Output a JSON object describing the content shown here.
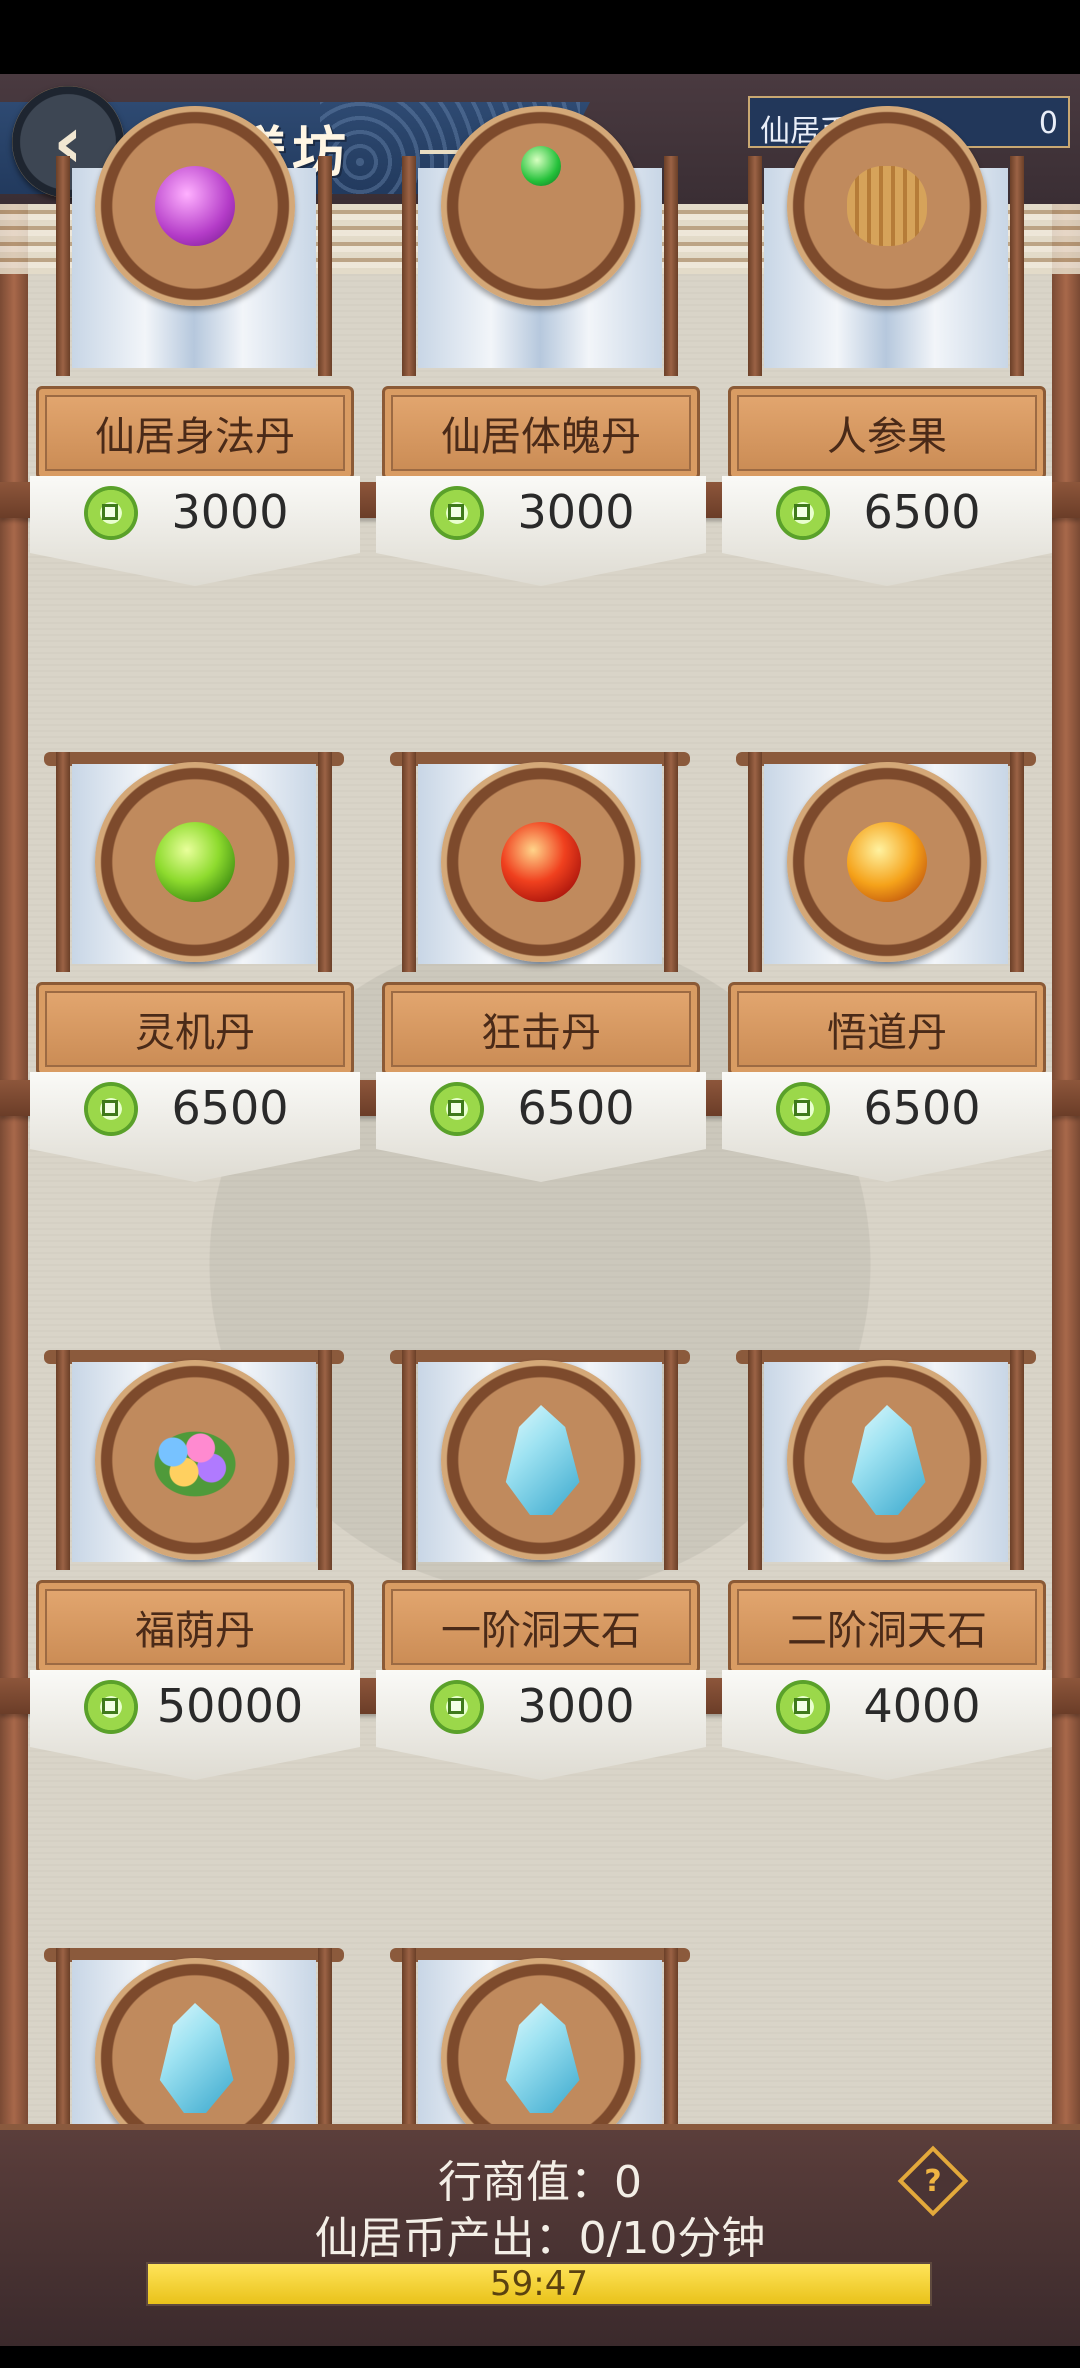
{
  "header": {
    "back_icon": "chevron-left-icon",
    "title": "珍馐坊",
    "currency_label": "仙居币",
    "currency_value": "0"
  },
  "items": [
    {
      "name": "仙居身法丹",
      "price": "3000",
      "icon": "purple-pill-icon"
    },
    {
      "name": "仙居体魄丹",
      "price": "3000",
      "icon": "green-pill-icon"
    },
    {
      "name": "人参果",
      "price": "6500",
      "icon": "ginseng-fruit-icon"
    },
    {
      "name": "灵机丹",
      "price": "6500",
      "icon": "green-orb-icon"
    },
    {
      "name": "狂击丹",
      "price": "6500",
      "icon": "red-orb-icon"
    },
    {
      "name": "悟道丹",
      "price": "6500",
      "icon": "orange-orb-icon"
    },
    {
      "name": "福荫丹",
      "price": "50000",
      "icon": "beads-on-leaf-icon"
    },
    {
      "name": "一阶洞天石",
      "price": "3000",
      "icon": "crystal-icon"
    },
    {
      "name": "二阶洞天石",
      "price": "4000",
      "icon": "crystal-icon"
    },
    {
      "name": "",
      "price": "",
      "icon": "crystal-icon"
    },
    {
      "name": "",
      "price": "",
      "icon": "crystal-icon"
    }
  ],
  "footer": {
    "merchant_value_text": "行商值：0",
    "output_text": "仙居币产出：0/10分钟",
    "timer_text": "59:47",
    "timer_progress": 1.0,
    "help_icon": "question-diamond-icon"
  },
  "colors": {
    "accent_blue": "#223a5e",
    "wood": "#8b5a3c",
    "progress_yellow": "#e9c21a",
    "coin_green": "#9bd84a"
  }
}
